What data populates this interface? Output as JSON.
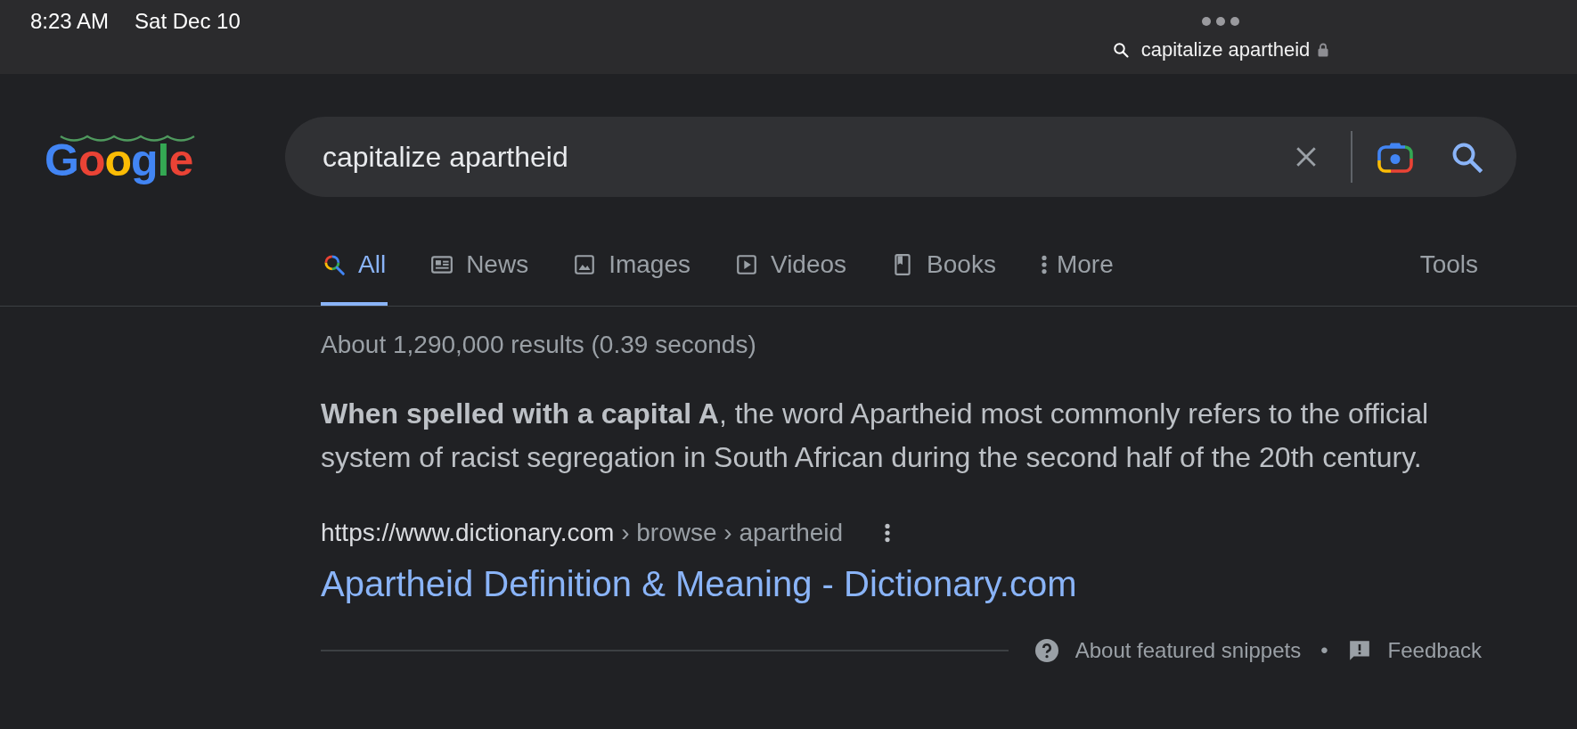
{
  "status_bar": {
    "time": "8:23 AM",
    "date": "Sat Dec 10",
    "address": "capitalize apartheid"
  },
  "logo": {
    "text": "Google"
  },
  "search": {
    "value": "capitalize apartheid"
  },
  "tabs": [
    {
      "kind": "all",
      "label": "All",
      "selected": true
    },
    {
      "kind": "news",
      "label": "News",
      "selected": false
    },
    {
      "kind": "images",
      "label": "Images",
      "selected": false
    },
    {
      "kind": "videos",
      "label": "Videos",
      "selected": false
    },
    {
      "kind": "books",
      "label": "Books",
      "selected": false
    },
    {
      "kind": "more",
      "label": "More",
      "selected": false
    }
  ],
  "tools": "Tools",
  "result_stats": "About 1,290,000 results (0.39 seconds)",
  "featured_snippet": {
    "text": "**When spelled with a capital A**, the word Apartheid most commonly refers to the official system of racist segregation in South African during the second half of the 20th century.",
    "url": "https://www.dictionary.com",
    "breadcrumb": "› browse › apartheid",
    "title": "Apartheid Definition & Meaning - Dictionary.com"
  },
  "footer": {
    "about": "About featured snippets",
    "separator": "•",
    "feedback": "Feedback"
  }
}
